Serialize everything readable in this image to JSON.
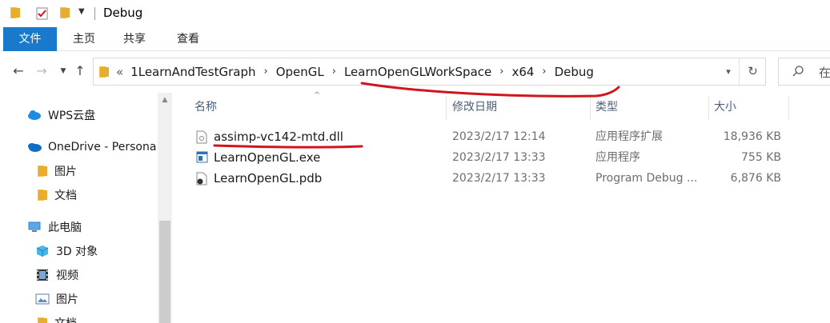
{
  "window": {
    "title": "Debug"
  },
  "ribbon": {
    "tabs": [
      "文件",
      "主页",
      "共享",
      "查看"
    ]
  },
  "address": {
    "overflow": "«",
    "crumbs": [
      "1LearnAndTestGraph",
      "OpenGL",
      "LearnOpenGLWorkSpace",
      "x64",
      "Debug"
    ],
    "search_placeholder": "在"
  },
  "sidebar": {
    "items": [
      {
        "label": "WPS云盘",
        "icon": "cloud-icon"
      },
      {
        "label": "OneDrive - Persona",
        "icon": "onedrive-icon"
      },
      {
        "label": "图片",
        "icon": "folder-icon"
      },
      {
        "label": "文档",
        "icon": "folder-icon"
      },
      {
        "label": "此电脑",
        "icon": "pc-icon"
      },
      {
        "label": "3D 对象",
        "icon": "cube-icon"
      },
      {
        "label": "视频",
        "icon": "video-icon"
      },
      {
        "label": "图片",
        "icon": "picture-icon"
      },
      {
        "label": "文档",
        "icon": "folder-icon"
      }
    ]
  },
  "columns": {
    "name": "名称",
    "date": "修改日期",
    "type": "类型",
    "size": "大小"
  },
  "files": [
    {
      "name": "assimp-vc142-mtd.dll",
      "date": "2023/2/17 12:14",
      "type": "应用程序扩展",
      "size": "18,936 KB",
      "icon": "dll-file-icon"
    },
    {
      "name": "LearnOpenGL.exe",
      "date": "2023/2/17 13:33",
      "type": "应用程序",
      "size": "755 KB",
      "icon": "exe-file-icon"
    },
    {
      "name": "LearnOpenGL.pdb",
      "date": "2023/2/17 13:33",
      "type": "Program Debug ...",
      "size": "6,876 KB",
      "icon": "pdb-file-icon"
    }
  ],
  "colors": {
    "accent": "#1979ca",
    "annotation": "#d0161c",
    "folder": "#f4c146"
  }
}
